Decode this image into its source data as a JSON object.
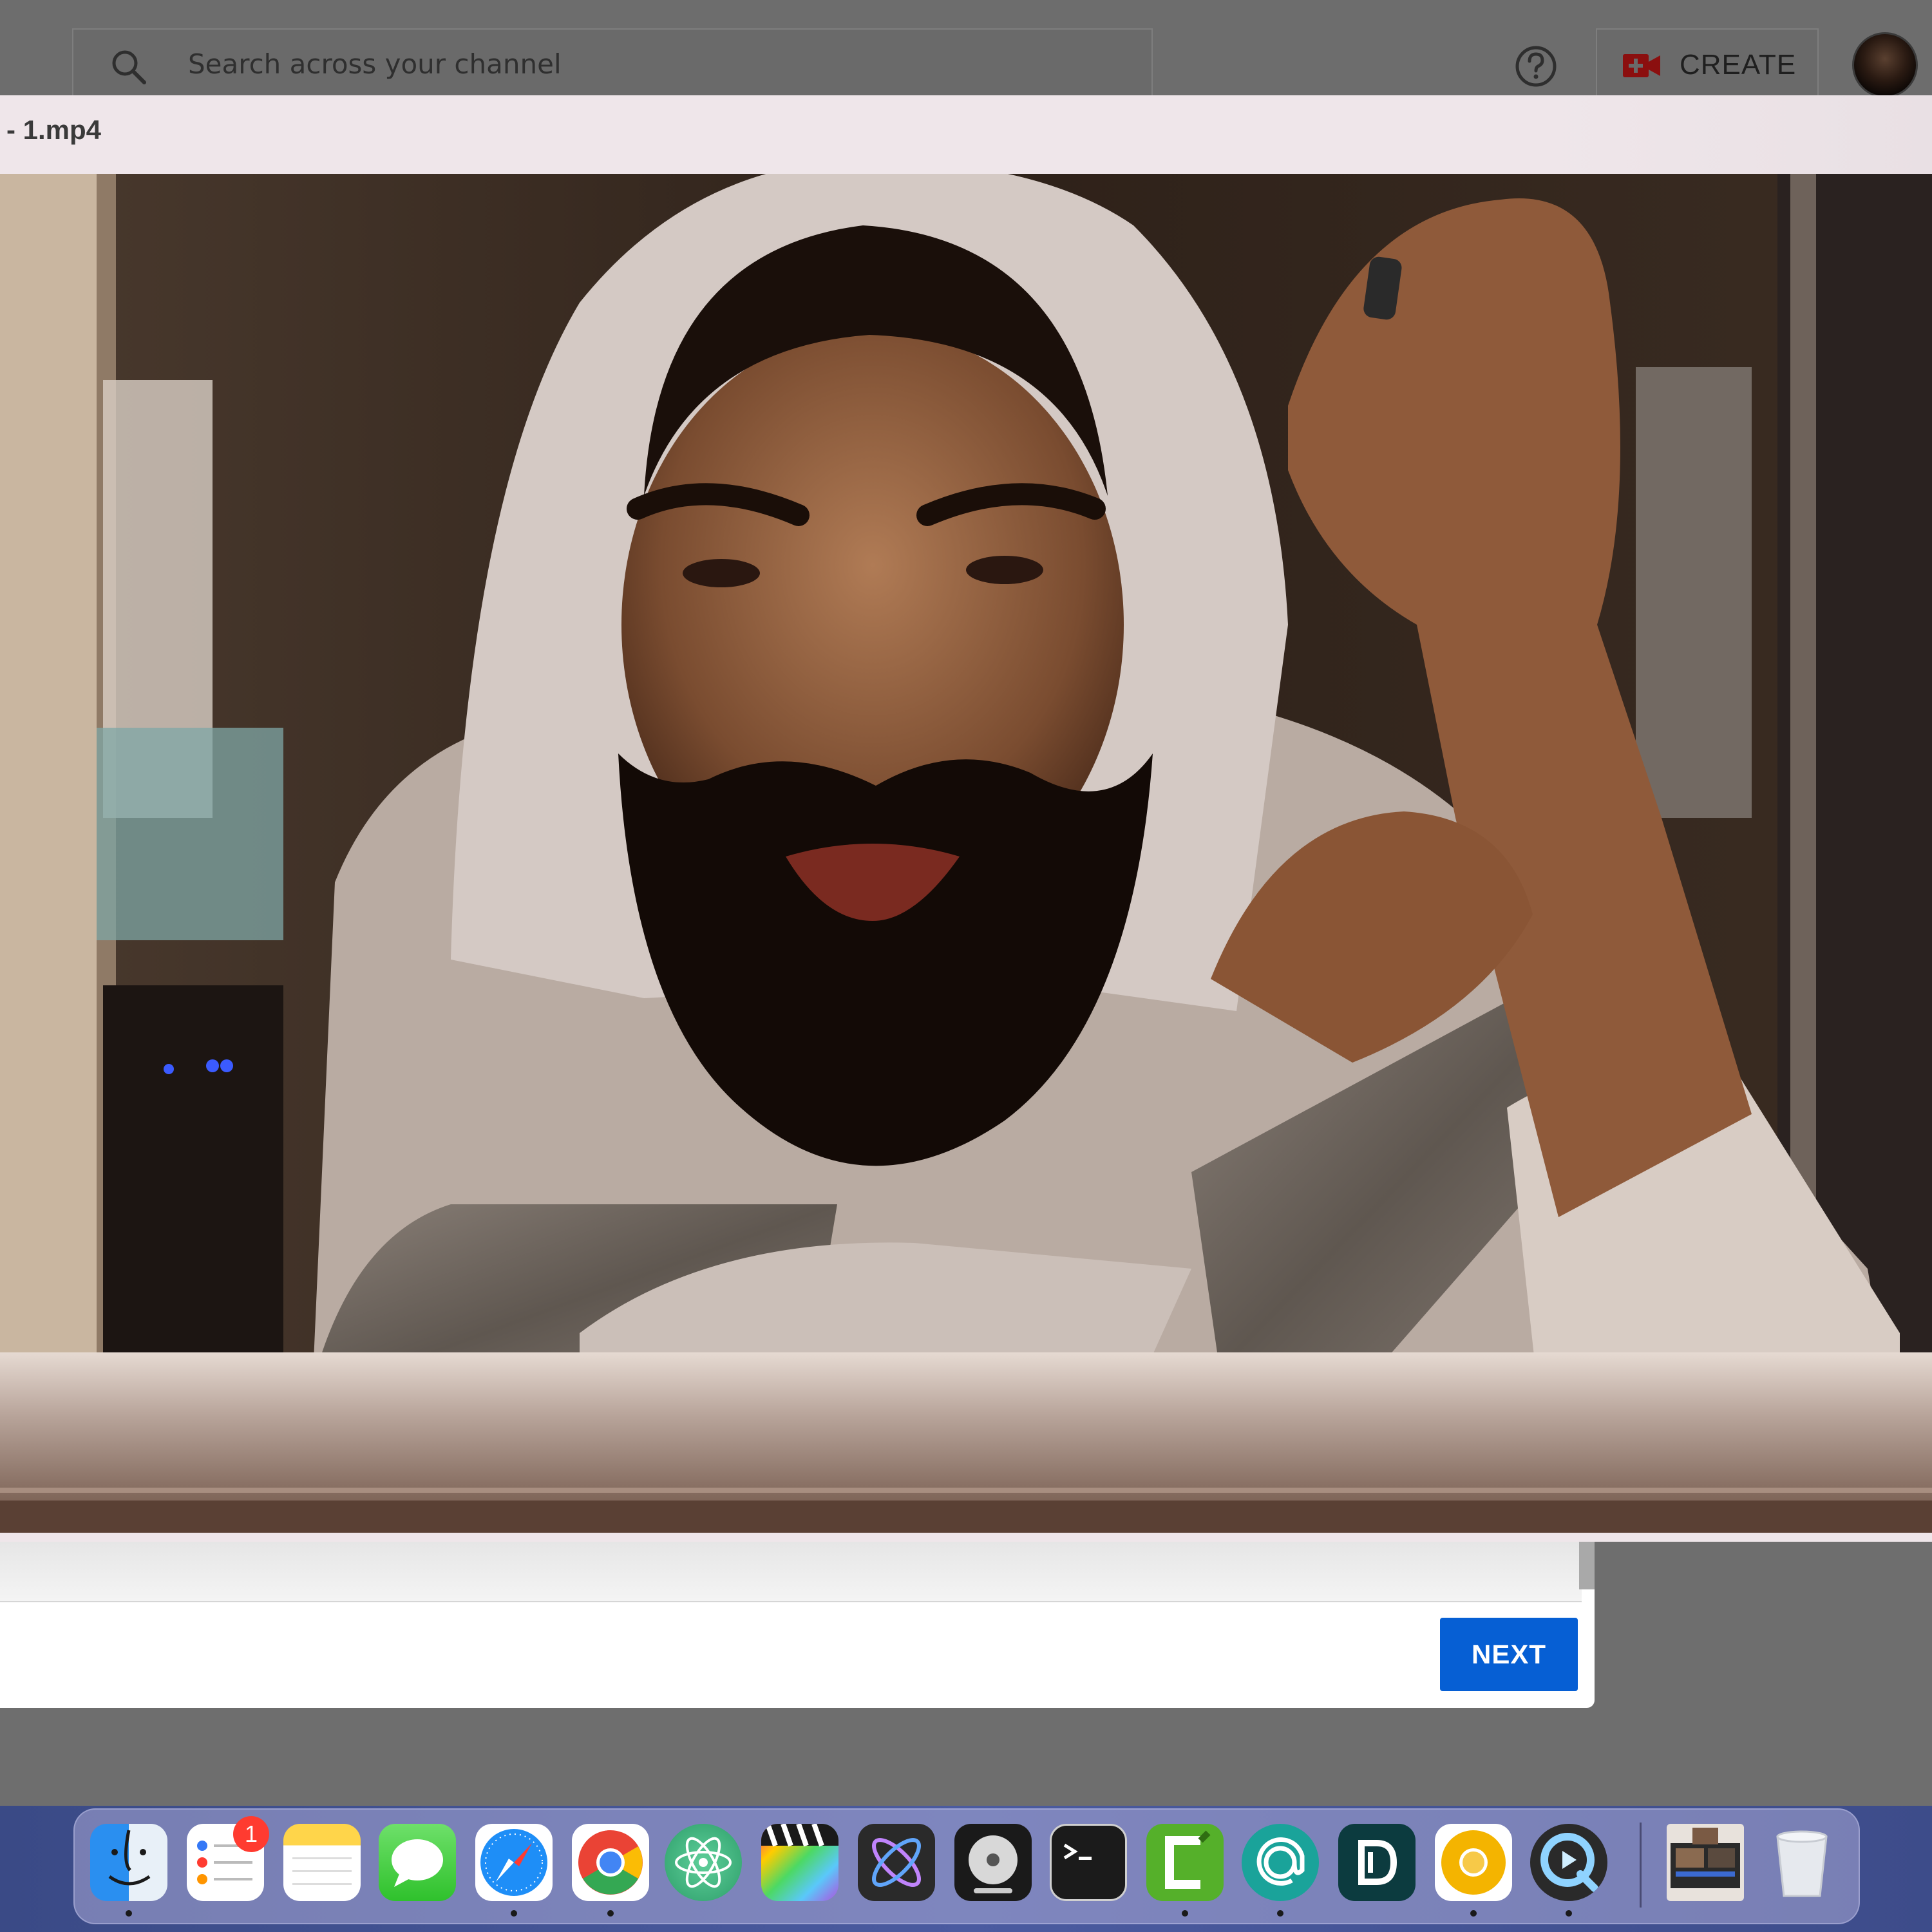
{
  "header": {
    "search_placeholder": "Search across your channel",
    "create_label": "CREATE"
  },
  "player": {
    "title": "- 1.mp4"
  },
  "dialog": {
    "next_label": "NEXT"
  },
  "dock": {
    "reminders_badge": "1",
    "apps": [
      "finder-icon",
      "reminders-icon",
      "notes-icon",
      "messages-icon",
      "safari-icon",
      "chrome-icon",
      "atom-icon",
      "final-cut-pro-icon",
      "motion-icon",
      "compressor-icon",
      "terminal-icon",
      "camtasia-icon",
      "spark-mail-icon",
      "dashlane-icon",
      "chrome-canary-icon",
      "quicktime-icon",
      "recent-document-icon",
      "trash-icon"
    ]
  },
  "colors": {
    "next_button": "#065fd4",
    "create_icon": "#8b0f0f",
    "badge": "#ff3b30"
  }
}
